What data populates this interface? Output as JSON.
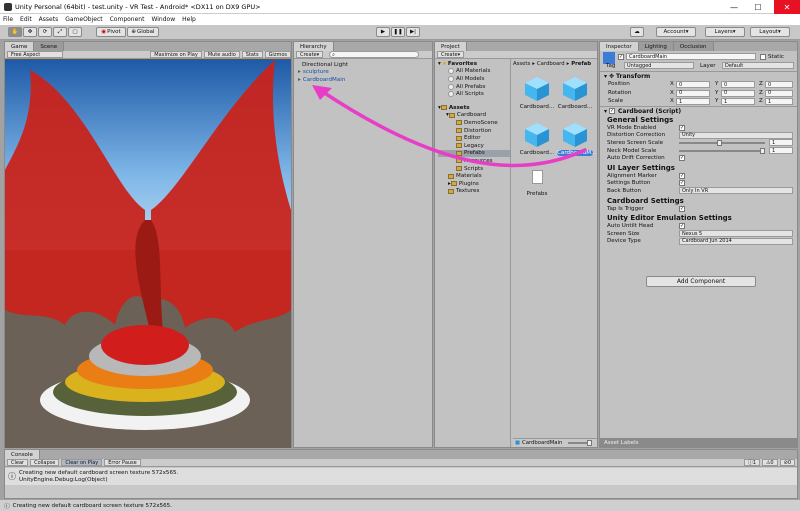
{
  "window": {
    "title": "Unity Personal (64bit) - test.unity - VR Test - Android* <DX11 on DX9 GPU>",
    "minimize": "—",
    "maximize": "☐",
    "close": "✕"
  },
  "menu": [
    "File",
    "Edit",
    "Assets",
    "GameObject",
    "Component",
    "Window",
    "Help"
  ],
  "toolbar": {
    "pivot": "Pivot",
    "global": "Global",
    "account": "Account",
    "layers": "Layers",
    "layout": "Layout"
  },
  "game": {
    "tabs": [
      "Game",
      "Scene"
    ],
    "aspect": "Free Aspect",
    "options": [
      "Maximize on Play",
      "Mute audio",
      "Stats",
      "Gizmos"
    ]
  },
  "hierarchy": {
    "tab": "Hierarchy",
    "create": "Create",
    "items": [
      "Directional Light",
      "sculpture",
      "CardboardMain"
    ]
  },
  "project": {
    "tab": "Project",
    "create": "Create",
    "breadcrumb": [
      "Assets",
      "Cardboard",
      "Prefab"
    ],
    "favorites_label": "Favorites",
    "favorites": [
      "All Materials",
      "All Models",
      "All Prefabs",
      "All Scripts"
    ],
    "assets_label": "Assets",
    "tree": [
      "Cardboard",
      "DemoScene",
      "Distortion",
      "Editor",
      "Legacy",
      "Prefabs",
      "Resources",
      "Scripts",
      "Materials",
      "Plugins",
      "Textures"
    ],
    "grid": [
      "Cardboard...",
      "Cardboard...",
      "Cardboard...",
      "CardboardM..."
    ],
    "folder_label": "Prefabs",
    "footer": "CardboardMain"
  },
  "inspector": {
    "tabs": [
      "Inspector",
      "Lighting",
      "Occlusion"
    ],
    "object_name": "CardboardMain",
    "static": "Static",
    "tag_label": "Tag",
    "tag": "Untagged",
    "layer_label": "Layer",
    "layer": "Default",
    "transform": "Transform",
    "transform_rows": [
      {
        "label": "Position",
        "x": "0",
        "y": "0",
        "z": "0"
      },
      {
        "label": "Rotation",
        "x": "0",
        "y": "0",
        "z": "0"
      },
      {
        "label": "Scale",
        "x": "1",
        "y": "1",
        "z": "1"
      }
    ],
    "component": "Cardboard (Script)",
    "general_hdr": "General Settings",
    "vr_mode": "VR Mode Enabled",
    "distortion": "Distortion Correction",
    "distortion_val": "Unity",
    "stereo": "Stereo Screen Scale",
    "stereo_val": "1",
    "stereo_level": 0.5,
    "neck": "Neck Model Scale",
    "neck_val": "1",
    "neck_level": 1,
    "auto_drift": "Auto Drift Correction",
    "ui_hdr": "UI Layer Settings",
    "alignment": "Alignment Marker",
    "settings_btn": "Settings Button",
    "back_btn": "Back Button",
    "back_val": "Only In VR",
    "cardboard_hdr": "Cardboard Settings",
    "tap": "Tap Is Trigger",
    "editor_hdr": "Unity Editor Emulation Settings",
    "auto_untilt": "Auto Untilt Head",
    "screen_size": "Screen Size",
    "screen_val": "Nexus 5",
    "device_type": "Device Type",
    "device_val": "Cardboard Jun 2014",
    "add_component": "Add Component",
    "asset_labels": "Asset Labels"
  },
  "console": {
    "tab": "Console",
    "buttons": [
      "Clear",
      "Collapse",
      "Clear on Play",
      "Error Pause"
    ],
    "line1": "Creating new default cardboard screen texture 572x565.",
    "line2": "UnityEngine.Debug:Log(Object)",
    "status": "Creating new default cardboard screen texture 572x565.",
    "counts": [
      "1",
      "0",
      "0"
    ]
  },
  "colors": {
    "accent": "#3d7cd6",
    "annotation": "#e83ec7",
    "sky": "#3a80c8",
    "ground": "#6b6157"
  }
}
